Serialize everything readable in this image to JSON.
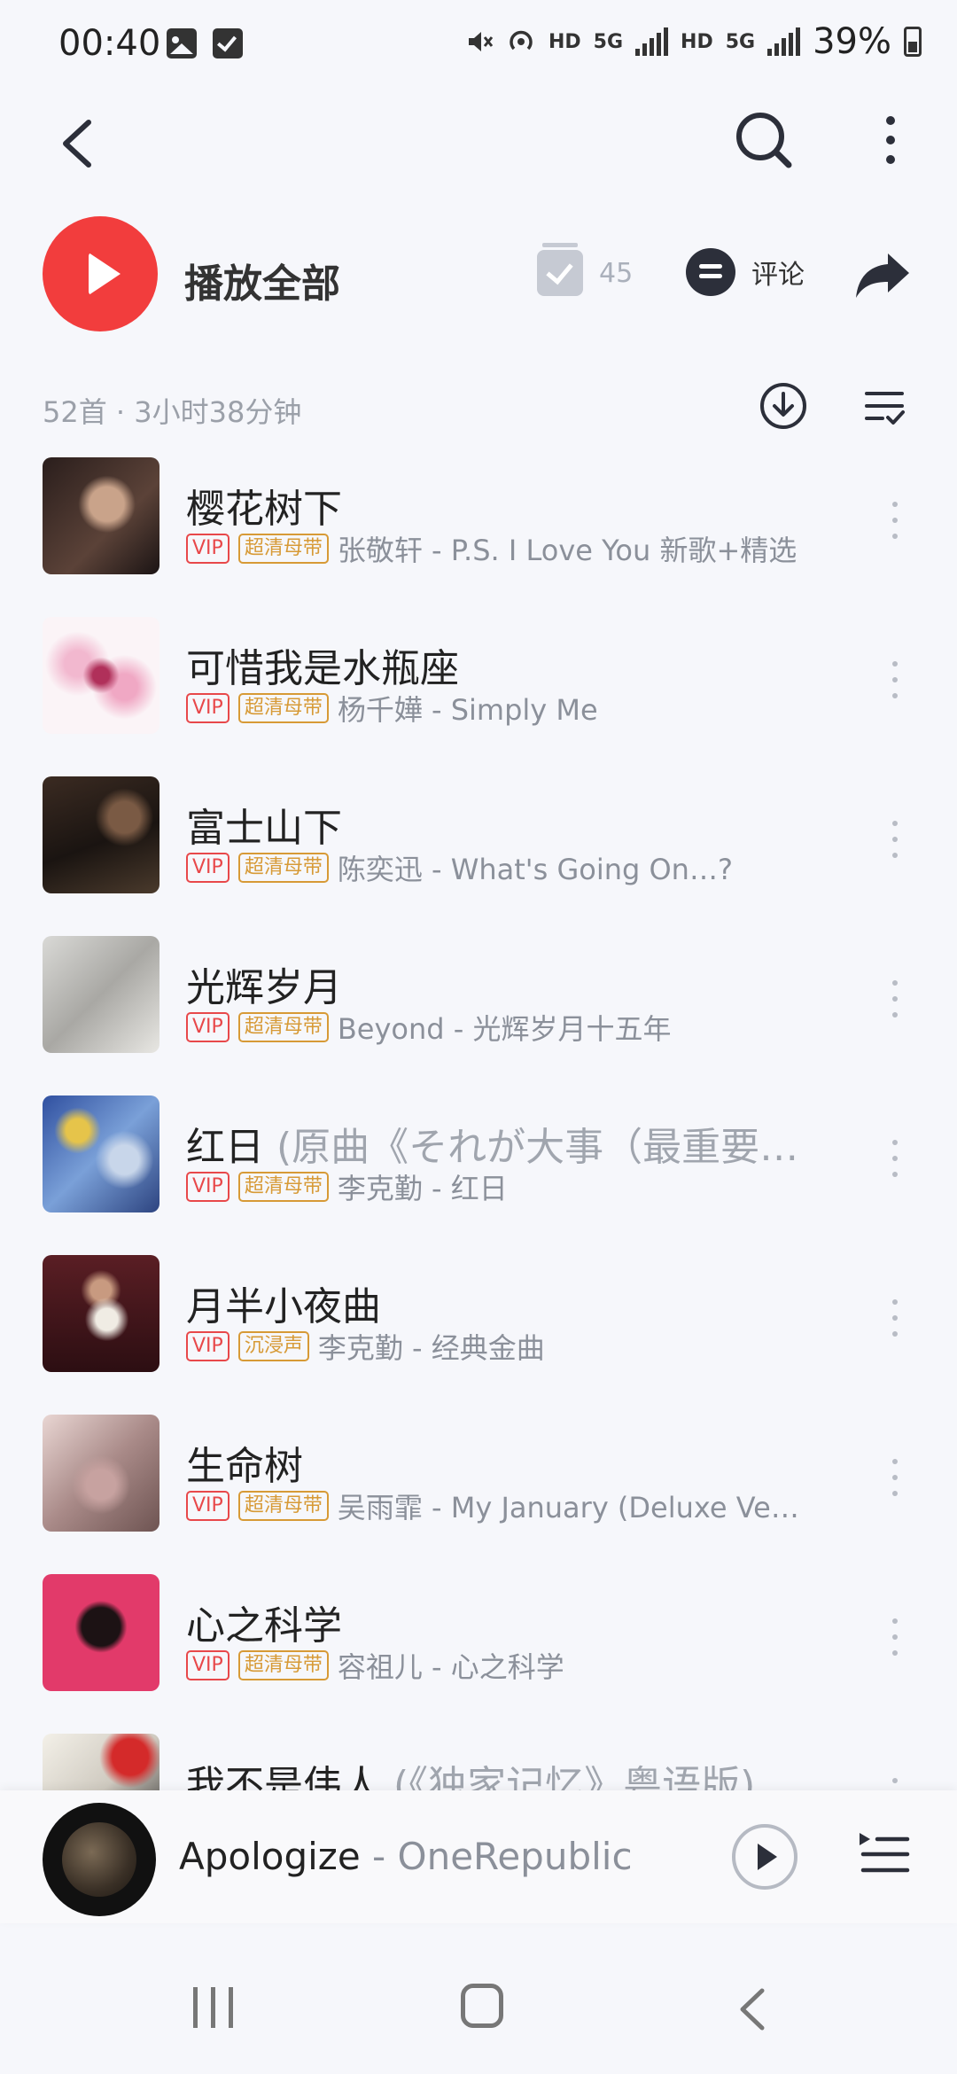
{
  "status_bar": {
    "time": "00:40",
    "network_labels": [
      "HD",
      "5G",
      "HD",
      "5G"
    ],
    "battery_percent": "39%"
  },
  "header": {
    "icons": [
      "back-icon",
      "search-icon",
      "more-vertical-icon"
    ]
  },
  "play_all": {
    "label": "播放全部",
    "collect_count": "45",
    "comment_label": "评论"
  },
  "meta": {
    "summary": "52首 · 3小时38分钟"
  },
  "songs": [
    {
      "title": "樱花树下",
      "subtitle": "",
      "tags": [
        "VIP",
        "超清母带"
      ],
      "artist": "张敬轩 - P.S. I Love You 新歌+精选"
    },
    {
      "title": "可惜我是水瓶座",
      "subtitle": "",
      "tags": [
        "VIP",
        "超清母带"
      ],
      "artist": "杨千嬅 - Simply Me"
    },
    {
      "title": "富士山下",
      "subtitle": "",
      "tags": [
        "VIP",
        "超清母带"
      ],
      "artist": "陈奕迅 - What's Going On…?"
    },
    {
      "title": "光辉岁月",
      "subtitle": "",
      "tags": [
        "VIP",
        "超清母带"
      ],
      "artist": "Beyond - 光辉岁月十五年"
    },
    {
      "title": "红日",
      "subtitle": " (原曲《それが大事（最重要…",
      "tags": [
        "VIP",
        "超清母带"
      ],
      "artist": "李克勤 - 红日"
    },
    {
      "title": "月半小夜曲",
      "subtitle": "",
      "tags": [
        "VIP",
        "沉浸声"
      ],
      "artist": "李克勤 - 经典金曲"
    },
    {
      "title": "生命树",
      "subtitle": "",
      "tags": [
        "VIP",
        "超清母带"
      ],
      "artist": "吴雨霏 - My January (Deluxe Ve…"
    },
    {
      "title": "心之科学",
      "subtitle": "",
      "tags": [
        "VIP",
        "超清母带"
      ],
      "artist": "容祖儿 - 心之科学"
    },
    {
      "title": "我不是伟人",
      "subtitle": " (《独家记忆》粤语版)",
      "tags": [],
      "artist": ""
    }
  ],
  "mini_player": {
    "song": "Apologize",
    "separator": " - ",
    "artist": "OneRepublic"
  },
  "colors": {
    "accent_red": "#f23d3d",
    "vip_red": "#e8484a",
    "quality_gold": "#d79a36"
  }
}
